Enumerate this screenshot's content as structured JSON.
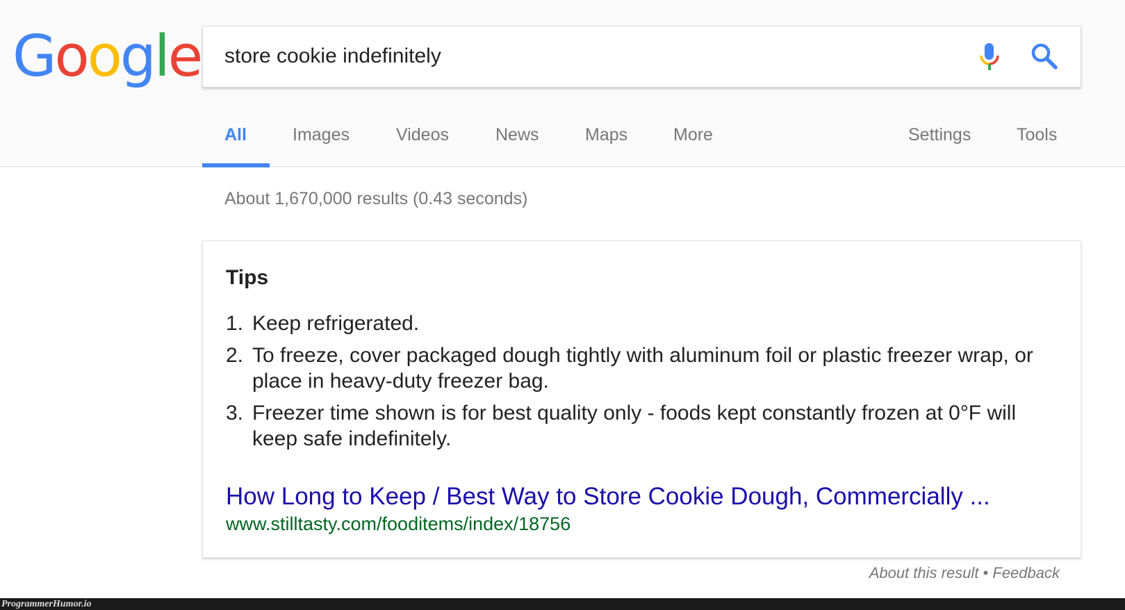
{
  "logo": {
    "letters": [
      "G",
      "o",
      "o",
      "g",
      "l",
      "e"
    ],
    "colors": [
      "#4285f4",
      "#ea4335",
      "#fbbc05",
      "#4285f4",
      "#34a853",
      "#ea4335"
    ]
  },
  "search": {
    "query": "store cookie indefinitely",
    "mic_icon": "microphone-icon",
    "search_icon": "magnifier-icon"
  },
  "tabs": [
    {
      "label": "All",
      "active": true
    },
    {
      "label": "Images"
    },
    {
      "label": "Videos"
    },
    {
      "label": "News"
    },
    {
      "label": "Maps"
    },
    {
      "label": "More"
    }
  ],
  "tools": {
    "settings": "Settings",
    "tools": "Tools"
  },
  "results_count": "About 1,670,000 results (0.43 seconds)",
  "snippet": {
    "title": "Tips",
    "items": [
      {
        "n": "1.",
        "text": "Keep refrigerated."
      },
      {
        "n": "2.",
        "text": "To freeze, cover packaged dough tightly with aluminum foil or plastic freezer wrap, or place in heavy-duty freezer bag."
      },
      {
        "n": "3.",
        "text": "Freezer time shown is for best quality only - foods kept constantly frozen at 0°F will keep safe indefinitely."
      }
    ],
    "link_title": "How Long to Keep / Best Way to Store Cookie Dough, Commercially ...",
    "url": "www.stilltasty.com/fooditems/index/18756"
  },
  "footer": {
    "about": "About this result",
    "sep": " • ",
    "feedback": "Feedback"
  },
  "watermark": "ProgrammerHumor.io",
  "colors": {
    "accent": "#4285f4",
    "link": "#1a0dab",
    "url": "#006621"
  }
}
